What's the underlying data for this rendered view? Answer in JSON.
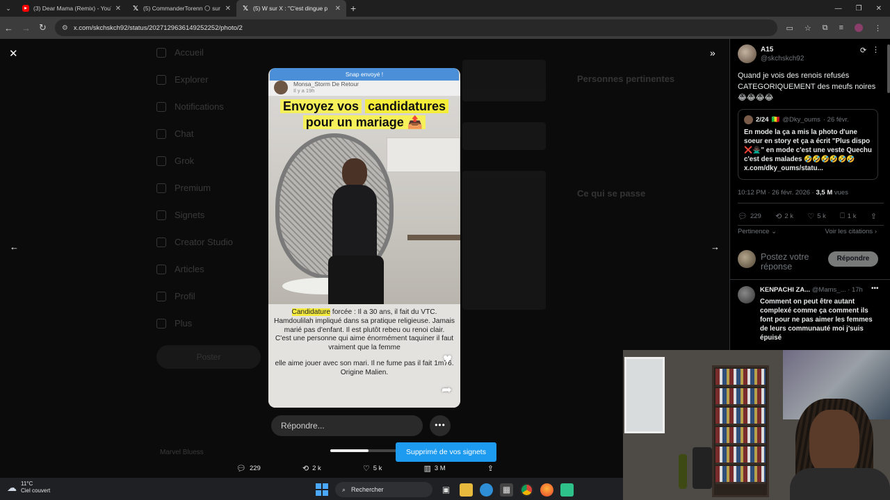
{
  "browser": {
    "tabs": [
      {
        "title": "(3) Dear Mama (Remix) - YouTube",
        "icon": "youtube-icon",
        "active": false
      },
      {
        "title": "(5) CommanderTorenn 🌕 sur X",
        "icon": "x-icon",
        "active": false
      },
      {
        "title": "(5) W    sur X : \"C'est dingue p",
        "icon": "x-icon",
        "active": true
      }
    ],
    "new_tab": "+",
    "url": "x.com/skchskch92/status/2027129636149252252/photo/2"
  },
  "media": {
    "snap_banner": "Snap envoyé !",
    "snap_user": "Monsa_Storm De Retour",
    "snap_time": "Il y a 19h",
    "title_line1_a": "Envoyez vos",
    "title_line1_b": "candidatures",
    "title_line2": "pour un mariage",
    "title_emoji": "📤",
    "caption_hl": "Candidature",
    "caption_p1": " forcée : Il a 30 ans, il fait du VTC. Hamdoulilah impliqué dans sa pratique religieuse. Jamais marié pas d'enfant. Il est plutôt rebeu ou renoi clair.",
    "caption_p2": "C'est une personne qui aime énormément taquiner il faut vraiment que la femme",
    "caption_p3": "elle aime jouer avec son mari. Il ne fume pas il fait 1m76. Origine Malien."
  },
  "reply": {
    "placeholder": "Répondre...",
    "more": "•••"
  },
  "toast": "Supprimé de vos signets",
  "video_progress": 0.55,
  "bottom_actions": {
    "replies": "229",
    "reposts": "2 k",
    "likes": "5 k",
    "views": "3 M"
  },
  "bg": {
    "sidebar": [
      "Accueil",
      "Explorer",
      "Notifications",
      "Chat",
      "Grok",
      "Premium",
      "Signets",
      "Creator Studio",
      "Articles",
      "Profil",
      "Plus"
    ],
    "post_button": "Poster",
    "right_heading1": "Personnes pertinentes",
    "right_heading2": "Ce qui se passe",
    "author": "Marvel Bluess"
  },
  "panel": {
    "name": "A15",
    "handle": "@skchskch92",
    "text": "Quand je vois des renois refusés CATEGORIQUEMENT des meufs noires😂😂😂😂",
    "quote": {
      "name": "2/24",
      "flag": "🇲🇱",
      "handle": "@Dky_oums",
      "date": "· 26 févr.",
      "text": "En mode la ça a mis la photo d'une soeur en story et ça a écrit \"Plus dispo ❌🙅🏿‍♂️\" en mode c'est une veste Quechu c'est des malades 🤣🤣🤣🤣🤣🤣 x.com/dky_oums/statu..."
    },
    "time": "10:12 PM · 26 févr. 2026 · ",
    "views_num": "3,5 M",
    "views_label": " vues",
    "stats": {
      "replies": "229",
      "reposts": "2 k",
      "likes": "5 k",
      "bookmarks": "1 k"
    },
    "sort": "Pertinence",
    "quotes_link": "Voir les citations",
    "reply_placeholder": "Postez votre réponse",
    "reply_button": "Répondre",
    "comment": {
      "name": "KENPACHI ZA...",
      "handle": "@Mams_...",
      "time": "· 17h",
      "text": "Comment on peut être autant complexé comme ça comment ils font pour ne pas aimer les femmes de leurs communauté moi j'suis épuisé"
    }
  },
  "taskbar": {
    "temp": "11°C",
    "weather": "Ciel couvert",
    "search": "Rechercher"
  },
  "colors": {
    "accent": "#1d9bf0",
    "snap_blue": "#4a8fd8",
    "highlight_yellow": "#f4ee3a"
  }
}
